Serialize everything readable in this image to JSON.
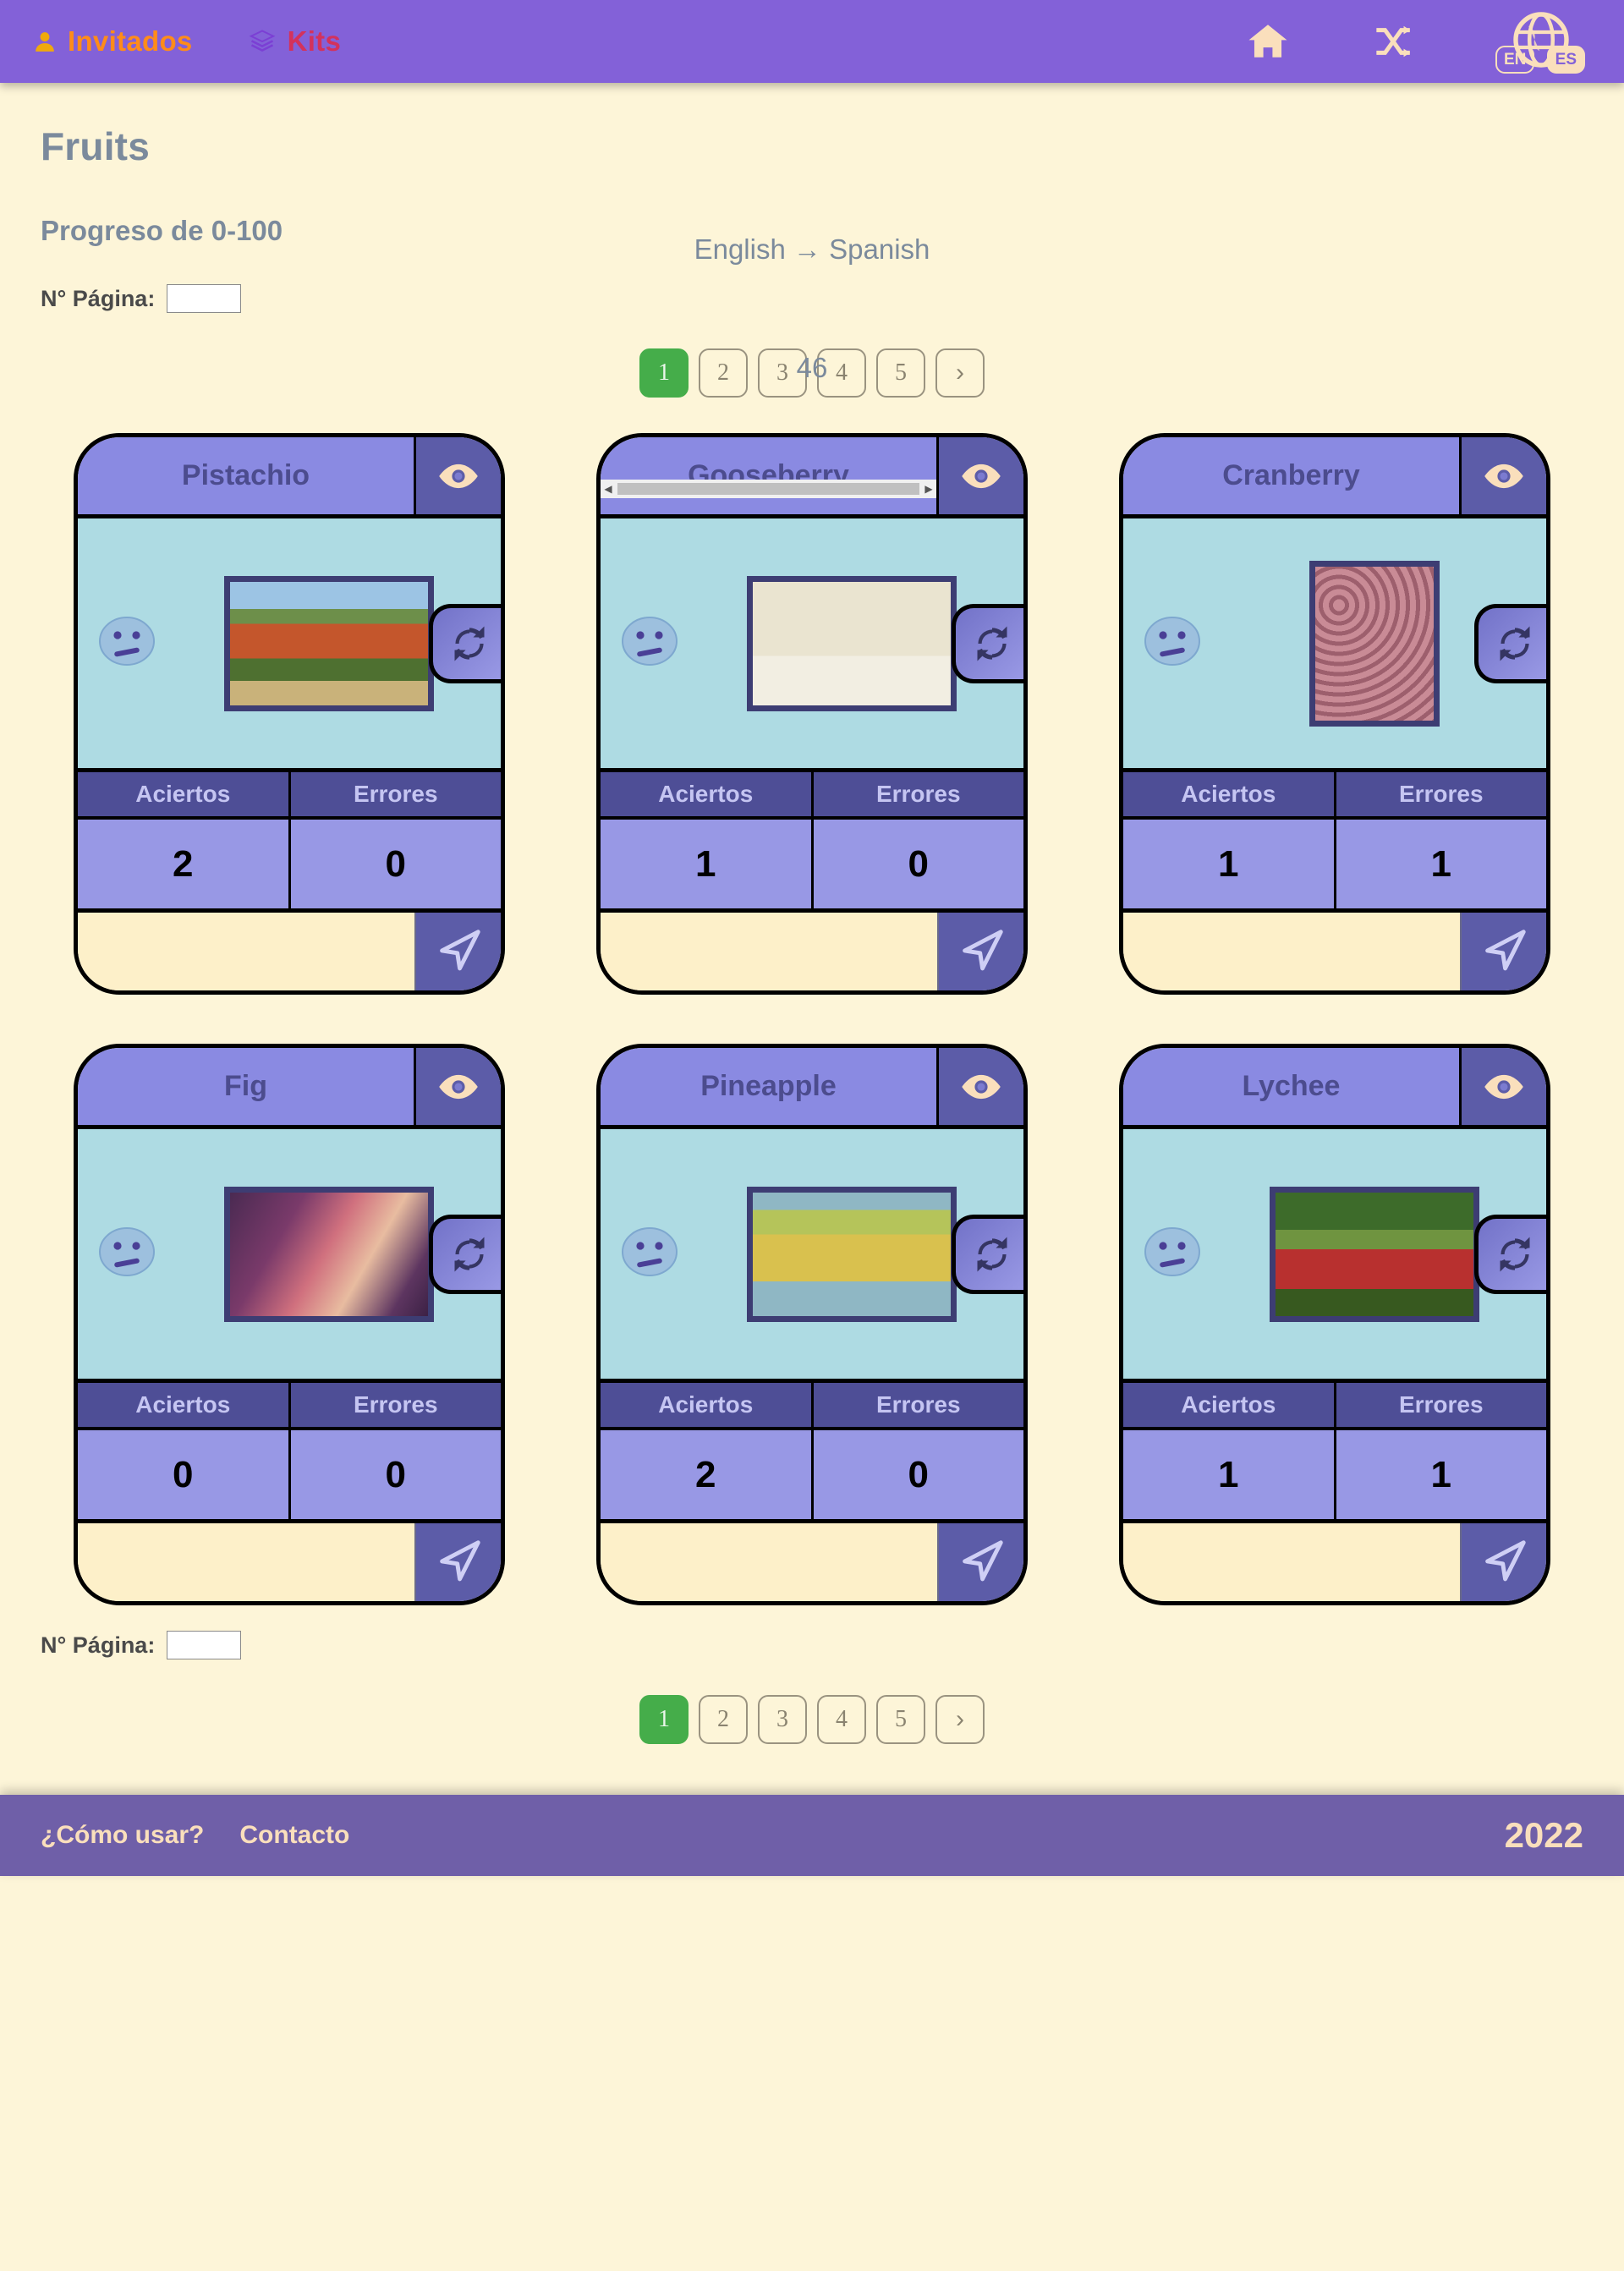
{
  "nav": {
    "links": [
      {
        "label": "Invitados",
        "icon": "user-icon",
        "color": "#ff8c1a"
      },
      {
        "label": "Kits",
        "icon": "layers-icon",
        "color": "#d3325c"
      }
    ],
    "icons": [
      {
        "name": "home-icon"
      },
      {
        "name": "shuffle-icon"
      },
      {
        "name": "globe-language-icon"
      }
    ],
    "lang_from": "EN",
    "lang_to": "ES",
    "background": "#8361d8"
  },
  "header": {
    "kit_title": "Fruits",
    "direction": "English → Spanish",
    "progress_label": "Progreso de 0-100",
    "progress_value": "46"
  },
  "pager_top": {
    "page_label": "N° Página:",
    "page_input_value": "",
    "pages": [
      "1",
      "2",
      "3",
      "4",
      "5"
    ],
    "active_page": "1",
    "next_label": "›"
  },
  "pager_bottom": {
    "page_label": "N° Página:",
    "page_input_value": "",
    "pages": [
      "1",
      "2",
      "3",
      "4",
      "5"
    ],
    "active_page": "1",
    "next_label": "›"
  },
  "card_labels": {
    "aciertos": "Aciertos",
    "errores": "Errores",
    "answer_placeholder": "",
    "eye_icon": "eye-icon",
    "refresh_icon": "refresh-icon",
    "face_icon": "neutral-face-icon",
    "send_icon": "send-arrow-icon"
  },
  "cards": [
    {
      "title": "Pistachio",
      "aciertos": "2",
      "errores": "0",
      "answer": "",
      "overflow": false,
      "photo": "pistachio-tree-photo",
      "photo_shape": "wide"
    },
    {
      "title": "Gooseberry",
      "aciertos": "1",
      "errores": "0",
      "answer": "",
      "overflow": true,
      "photo": "gooseberry-chart-photo",
      "photo_shape": "wide"
    },
    {
      "title": "Cranberry",
      "aciertos": "1",
      "errores": "1",
      "answer": "",
      "overflow": false,
      "photo": "cranberry-berries-photo",
      "photo_shape": "tall"
    },
    {
      "title": "Fig",
      "aciertos": "0",
      "errores": "0",
      "answer": "",
      "overflow": false,
      "photo": "figs-photo",
      "photo_shape": "wide"
    },
    {
      "title": "Pineapple",
      "aciertos": "2",
      "errores": "0",
      "answer": "",
      "overflow": false,
      "photo": "pineapple-photo",
      "photo_shape": "wide"
    },
    {
      "title": "Lychee",
      "aciertos": "1",
      "errores": "1",
      "answer": "",
      "overflow": false,
      "photo": "lychee-branch-photo",
      "photo_shape": "wide"
    }
  ],
  "footer": {
    "links": [
      "¿Cómo usar?",
      "Contacto"
    ],
    "year": "2022",
    "background": "#6f5fa8"
  }
}
